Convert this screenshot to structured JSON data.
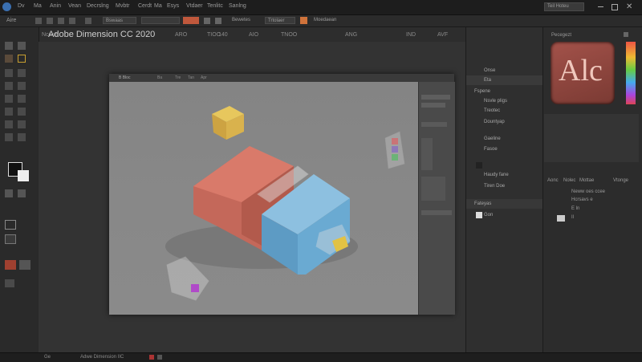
{
  "menubar": {
    "items": [
      "Dv",
      "Ma",
      "Anin",
      "Vean",
      "Decrslng",
      "Mvbtr",
      "Cerdt",
      "Ma",
      "Esys",
      "Vtdaer",
      "Tenlitc",
      "Sanlng"
    ],
    "search_placeholder": "Teil Hoteu"
  },
  "options_bar": {
    "left_label": "Aire",
    "field1": "Bswaas",
    "field2": "",
    "field3": "Bewetes",
    "field4": "Trtolaer",
    "field5": "Moedaean"
  },
  "document": {
    "title_prefix": "Nccne",
    "title": "Adobe Dimension CC 2020",
    "ruler_labels": [
      "ARO",
      "TIOO",
      "140",
      "AIO",
      "TNOO",
      "ANG",
      "IND",
      "AVF"
    ]
  },
  "right_panel": {
    "tab_label": "Pecegezt",
    "logo_text": "Alc",
    "lower_tabs": [
      "Aonc",
      "Nolec",
      "Mottae",
      "Vtonge"
    ],
    "lower_rows": [
      "Neww oes  ccee",
      "Hcrsavs  e",
      "E  ln",
      "Il"
    ]
  },
  "layers": {
    "rows": [
      "Onse",
      "Eta",
      "Fspene",
      "Nsvle pligs",
      "Treotec",
      "Dountyap",
      "Gaeline",
      "Fasoe",
      "Haudy fane",
      "Tiren Doe",
      "Fateyas",
      "Gon"
    ]
  },
  "inner_window": {
    "title": "B Bloc",
    "menu": [
      "Ba",
      "Tre",
      "Tan",
      "Apr"
    ]
  },
  "statusbar": {
    "left": "Ge",
    "app_label": "Adwe Dimension IIC"
  },
  "colors": {
    "red_box": "#c96a5a",
    "blue_box": "#6aa8cf",
    "yellow_cube": "#d8b64a",
    "logo_bg": "#8f463e"
  }
}
